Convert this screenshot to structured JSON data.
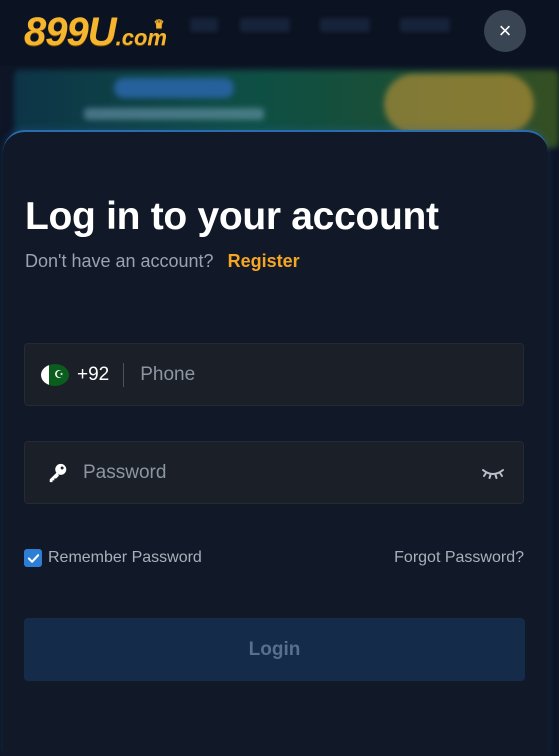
{
  "brand": {
    "logo_main": "899U",
    "logo_suffix": ".com"
  },
  "header": {
    "close_icon": "×"
  },
  "modal": {
    "title": "Log in to your account",
    "subtitle": "Don't have an account?",
    "register_link": "Register",
    "phone": {
      "country_code": "+92",
      "placeholder": "Phone",
      "value": ""
    },
    "password": {
      "placeholder": "Password",
      "value": ""
    },
    "remember_label": "Remember Password",
    "remember_checked": true,
    "forgot_link": "Forgot Password?",
    "login_button": "Login"
  },
  "colors": {
    "accent": "#f5a623",
    "background": "#111827",
    "checkbox": "#2d7fd6",
    "login_button_bg": "#142b4a"
  }
}
